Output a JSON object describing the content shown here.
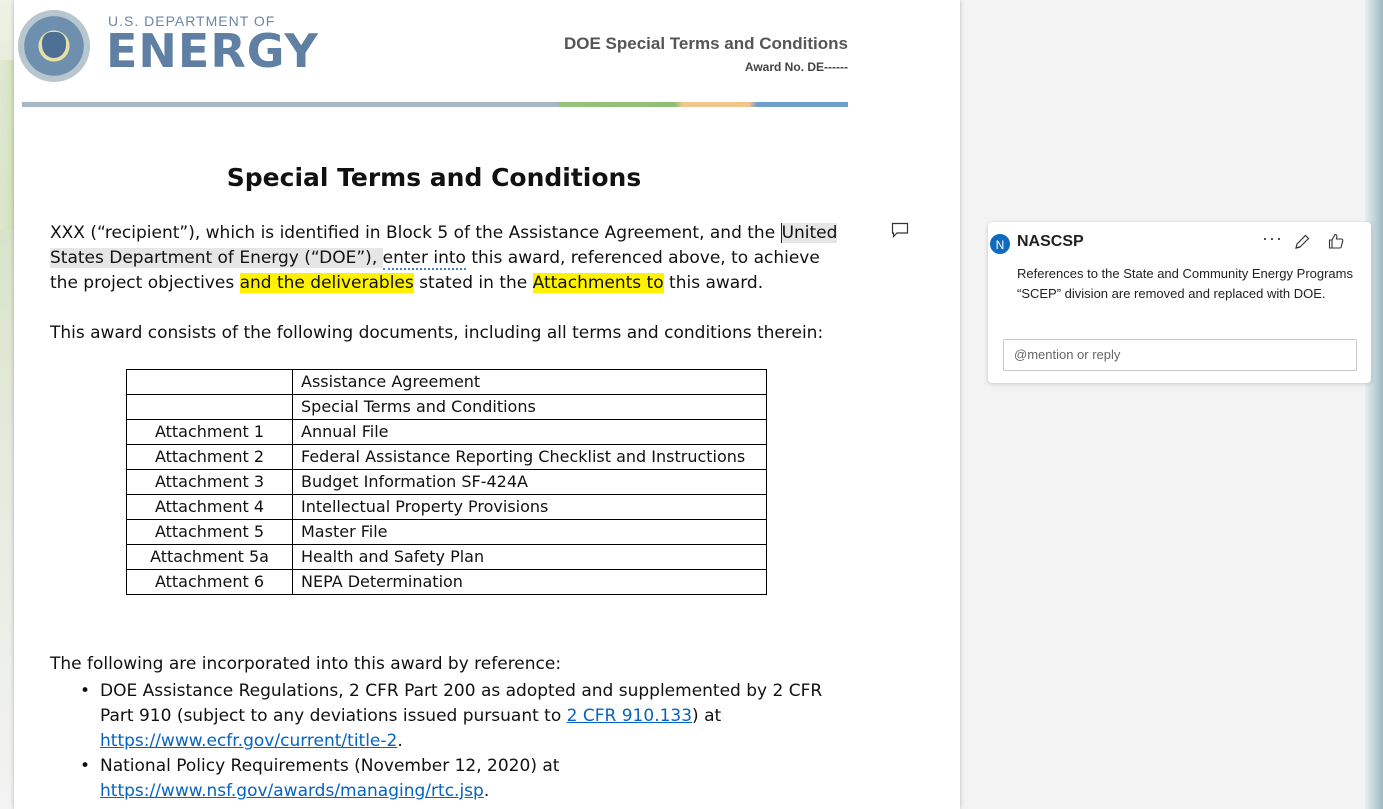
{
  "header": {
    "logo_line1": "U.S. DEPARTMENT OF",
    "logo_line2": "ENERGY",
    "doc_title": "DOE Special Terms and Conditions",
    "award_no": "Award No. DE------"
  },
  "document": {
    "title": "Special Terms and Conditions",
    "para1": {
      "a": "XXX (“recipient”), which is identified in Block 5 of the Assistance Agreement, and the ",
      "b": "United States Department of Energy (“DOE”), ",
      "c": "enter into",
      "d": " this award, referenced above, to achieve the project objectives ",
      "e": "and the deliverables",
      "f": " stated in the ",
      "g": "Attachments to",
      "h": " this award."
    },
    "para2": "This award consists of the following documents, including all terms and conditions therein:",
    "table": [
      [
        "",
        "Assistance Agreement"
      ],
      [
        "",
        "Special Terms and Conditions"
      ],
      [
        "Attachment 1",
        "Annual File"
      ],
      [
        "Attachment 2",
        "Federal Assistance Reporting Checklist and Instructions"
      ],
      [
        "Attachment 3",
        "Budget Information SF-424A"
      ],
      [
        "Attachment 4",
        "Intellectual Property Provisions"
      ],
      [
        "Attachment 5",
        "Master File"
      ],
      [
        "Attachment 5a",
        "Health and Safety Plan"
      ],
      [
        "Attachment 6",
        "NEPA Determination"
      ]
    ],
    "para3": "The following are incorporated into this award by reference:",
    "refs": [
      {
        "a": "DOE Assistance Regulations, 2 CFR Part 200 as adopted and supplemented by 2 CFR Part 910 (subject to any deviations issued pursuant to ",
        "link1": "2 CFR 910.133",
        "b": ") at ",
        "link2": "https://www.ecfr.gov/current/title-2",
        "c": "."
      },
      {
        "a": "National Policy Requirements (November 12, 2020) at ",
        "link1": "https://www.nsf.gov/awards/managing/rtc.jsp",
        "b": "."
      }
    ]
  },
  "comment": {
    "avatar_initial": "N",
    "author": "NASCSP",
    "more": "···",
    "text": "References to the State and Community Energy Programs “SCEP” division are removed and replaced with DOE.",
    "reply_placeholder": "@mention or reply"
  },
  "colors": {
    "highlight": "#fff200",
    "link": "#0563c1",
    "avatar": "#0f6cbd",
    "logo": "#5f7fa3"
  }
}
